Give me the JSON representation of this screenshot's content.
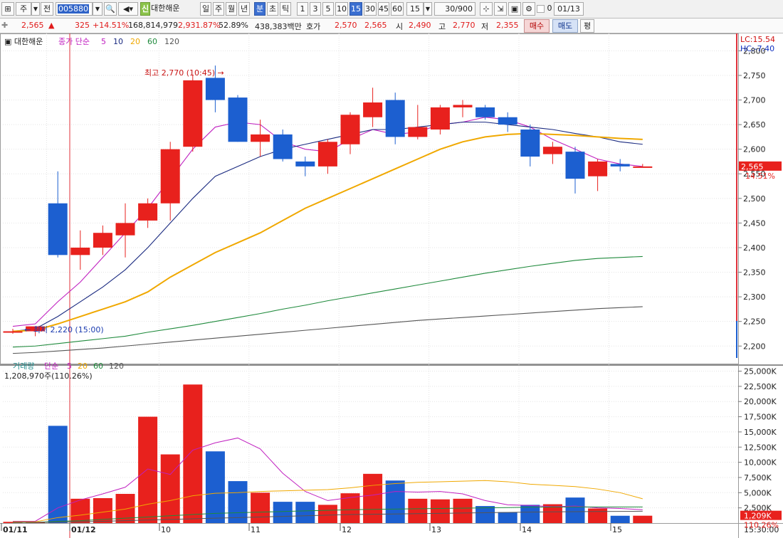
{
  "toolbar": {
    "period_unit": "주",
    "prev_label": "전",
    "code": "005880",
    "new_badge": "신",
    "stock_name": "대한해운",
    "period_buttons": [
      "일",
      "주",
      "월",
      "년",
      "분",
      "초",
      "틱"
    ],
    "active_period": "분",
    "interval_buttons": [
      "1",
      "3",
      "5",
      "10",
      "15",
      "30",
      "45",
      "60"
    ],
    "active_interval": "15",
    "interval_select": "15",
    "count_display": "30/900",
    "date_value": "01/13",
    "checkbox_label": "0"
  },
  "quote": {
    "price": "2,565",
    "change_arrow": "▲",
    "change": "325",
    "change_pct": "+14.51%",
    "volume": "168,814,979",
    "volume_pct": "2,931.87%",
    "ratio": "52.89%",
    "amount": "438,383백만",
    "ask_label": "호가",
    "ask": "2,570",
    "bid": "2,565",
    "open_label": "시",
    "open": "2,490",
    "high_label": "고",
    "high": "2,770",
    "low_label": "저",
    "low": "2,355",
    "buy_label": "매수",
    "sell_label": "매도",
    "eval_label": "평"
  },
  "price_panel": {
    "title": "대한해운",
    "indicator_label": "종가 단순",
    "ma_periods": [
      "5",
      "10",
      "20",
      "60",
      "120"
    ],
    "ma_colors": [
      "#c020c0",
      "#1a2a80",
      "#f0a800",
      "#1f8a3c",
      "#555555"
    ],
    "high_annotation": "최고 2,770 (10:45)",
    "low_annotation": "최저 2,220 (15:00)",
    "lc_label": "LC:15.54",
    "hc_label": "HC:-7.40",
    "current_price_tag": "2,565",
    "current_pct_tag": "14.51%"
  },
  "volume_panel": {
    "title": "거래량",
    "indicator_label": "단순",
    "ma_periods": [
      "5",
      "20",
      "60",
      "120"
    ],
    "ma_colors": [
      "#c020c0",
      "#f0a800",
      "#1f8a3c",
      "#555555"
    ],
    "current_value": "1,208,970주(110.26%)",
    "current_tag": "1,209K",
    "current_pct_tag": "110.26%"
  },
  "x_axis": {
    "labels": [
      "01/11",
      "01/12",
      "10",
      "11",
      "12",
      "13",
      "14",
      "15"
    ],
    "time_label": "15:30:00"
  },
  "chart_data": [
    {
      "type": "candlestick",
      "title": "대한해운",
      "y_ticks": [
        2200,
        2250,
        2300,
        2350,
        2400,
        2450,
        2500,
        2550,
        2600,
        2650,
        2700,
        2750,
        2800
      ],
      "ylim": [
        2170,
        2815
      ],
      "candles": [
        {
          "o": 2230,
          "h": 2235,
          "l": 2225,
          "c": 2230
        },
        {
          "o": 2230,
          "h": 2240,
          "l": 2220,
          "c": 2240
        },
        {
          "o": 2490,
          "h": 2555,
          "l": 2380,
          "c": 2385
        },
        {
          "o": 2385,
          "h": 2435,
          "l": 2355,
          "c": 2400
        },
        {
          "o": 2400,
          "h": 2445,
          "l": 2385,
          "c": 2430
        },
        {
          "o": 2425,
          "h": 2490,
          "l": 2380,
          "c": 2450
        },
        {
          "o": 2455,
          "h": 2500,
          "l": 2440,
          "c": 2490
        },
        {
          "o": 2490,
          "h": 2615,
          "l": 2455,
          "c": 2600
        },
        {
          "o": 2605,
          "h": 2750,
          "l": 2595,
          "c": 2740
        },
        {
          "o": 2745,
          "h": 2770,
          "l": 2675,
          "c": 2700
        },
        {
          "o": 2705,
          "h": 2710,
          "l": 2615,
          "c": 2615
        },
        {
          "o": 2615,
          "h": 2660,
          "l": 2585,
          "c": 2630
        },
        {
          "o": 2630,
          "h": 2640,
          "l": 2575,
          "c": 2580
        },
        {
          "o": 2575,
          "h": 2585,
          "l": 2545,
          "c": 2565
        },
        {
          "o": 2565,
          "h": 2620,
          "l": 2550,
          "c": 2615
        },
        {
          "o": 2610,
          "h": 2675,
          "l": 2590,
          "c": 2670
        },
        {
          "o": 2665,
          "h": 2725,
          "l": 2645,
          "c": 2695
        },
        {
          "o": 2700,
          "h": 2715,
          "l": 2610,
          "c": 2625
        },
        {
          "o": 2625,
          "h": 2690,
          "l": 2620,
          "c": 2645
        },
        {
          "o": 2640,
          "h": 2690,
          "l": 2630,
          "c": 2685
        },
        {
          "o": 2685,
          "h": 2700,
          "l": 2665,
          "c": 2690
        },
        {
          "o": 2685,
          "h": 2690,
          "l": 2660,
          "c": 2665
        },
        {
          "o": 2665,
          "h": 2675,
          "l": 2635,
          "c": 2650
        },
        {
          "o": 2640,
          "h": 2650,
          "l": 2565,
          "c": 2585
        },
        {
          "o": 2590,
          "h": 2615,
          "l": 2570,
          "c": 2605
        },
        {
          "o": 2595,
          "h": 2605,
          "l": 2510,
          "c": 2540
        },
        {
          "o": 2545,
          "h": 2580,
          "l": 2515,
          "c": 2575
        },
        {
          "o": 2570,
          "h": 2580,
          "l": 2555,
          "c": 2565
        },
        {
          "o": 2565,
          "h": 2570,
          "l": 2565,
          "c": 2565
        }
      ],
      "series": [
        {
          "name": "5",
          "values": [
            2240,
            2245,
            2290,
            2330,
            2380,
            2430,
            2480,
            2540,
            2600,
            2645,
            2655,
            2650,
            2615,
            2600,
            2595,
            2620,
            2640,
            2630,
            2635,
            2650,
            2655,
            2665,
            2660,
            2645,
            2620,
            2600,
            2580,
            2570,
            2565
          ]
        },
        {
          "name": "10",
          "values": [
            2230,
            2235,
            2260,
            2290,
            2320,
            2355,
            2400,
            2450,
            2500,
            2545,
            2565,
            2585,
            2600,
            2610,
            2620,
            2630,
            2640,
            2640,
            2645,
            2650,
            2655,
            2655,
            2650,
            2645,
            2640,
            2632,
            2625,
            2615,
            2610
          ]
        },
        {
          "name": "20",
          "values": [
            2230,
            2232,
            2245,
            2260,
            2275,
            2290,
            2310,
            2340,
            2365,
            2390,
            2410,
            2430,
            2455,
            2480,
            2500,
            2520,
            2540,
            2560,
            2580,
            2600,
            2615,
            2625,
            2630,
            2632,
            2630,
            2628,
            2625,
            2622,
            2620
          ]
        },
        {
          "name": "60",
          "values": [
            2198,
            2200,
            2205,
            2210,
            2215,
            2220,
            2228,
            2235,
            2242,
            2250,
            2258,
            2266,
            2275,
            2283,
            2292,
            2300,
            2308,
            2316,
            2324,
            2332,
            2340,
            2348,
            2355,
            2362,
            2368,
            2374,
            2378,
            2380,
            2382
          ]
        },
        {
          "name": "120",
          "values": [
            2185,
            2187,
            2190,
            2193,
            2196,
            2200,
            2204,
            2208,
            2212,
            2216,
            2220,
            2224,
            2228,
            2232,
            2236,
            2240,
            2244,
            2248,
            2252,
            2255,
            2258,
            2261,
            2264,
            2267,
            2270,
            2273,
            2276,
            2278,
            2280
          ]
        }
      ]
    },
    {
      "type": "bar",
      "title": "거래량",
      "y_ticks": [
        2500,
        5000,
        7500,
        10000,
        12500,
        15000,
        17500,
        20000,
        22500,
        25000
      ],
      "y_tick_labels": [
        "2,500K",
        "5,000K",
        "7,500K",
        "10,000K",
        "12,500K",
        "15,000K",
        "17,500K",
        "20,000K",
        "22,500K",
        "25,000K"
      ],
      "ylim": [
        0,
        26000
      ],
      "values": [
        200,
        200,
        16000,
        4000,
        4100,
        4800,
        17500,
        11300,
        22800,
        11800,
        6900,
        5000,
        3500,
        3500,
        3000,
        4900,
        8100,
        7000,
        4000,
        3900,
        4000,
        2800,
        1800,
        3000,
        3100,
        4200,
        2400,
        1200,
        1209
      ],
      "series": [
        {
          "name": "5",
          "values": [
            300,
            300,
            2500,
            3800,
            4800,
            5900,
            8900,
            8000,
            12000,
            13200,
            14000,
            12200,
            8200,
            5200,
            3700,
            4200,
            4600,
            5200,
            5100,
            5200,
            4800,
            3700,
            3000,
            2900,
            2700,
            2800,
            2500,
            2400,
            2200
          ]
        },
        {
          "name": "20",
          "values": [
            200,
            200,
            900,
            1300,
            1800,
            2300,
            3100,
            3700,
            4500,
            4900,
            5000,
            5200,
            5300,
            5400,
            5500,
            5800,
            6200,
            6500,
            6700,
            6800,
            6900,
            7000,
            6800,
            6400,
            6200,
            6000,
            5600,
            5000,
            4000
          ]
        },
        {
          "name": "60",
          "values": [
            100,
            100,
            300,
            400,
            600,
            800,
            1000,
            1200,
            1400,
            1600,
            1700,
            1800,
            1900,
            2000,
            2100,
            2200,
            2250,
            2300,
            2350,
            2400,
            2450,
            2500,
            2550,
            2600,
            2650,
            2650,
            2650,
            2650,
            2650
          ]
        },
        {
          "name": "120",
          "values": [
            100,
            100,
            150,
            200,
            300,
            400,
            500,
            600,
            700,
            800,
            900,
            1000,
            1100,
            1200,
            1300,
            1400,
            1450,
            1500,
            1550,
            1600,
            1650,
            1700,
            1750,
            1800,
            1850,
            1880,
            1900,
            1920,
            1940
          ]
        }
      ]
    }
  ]
}
